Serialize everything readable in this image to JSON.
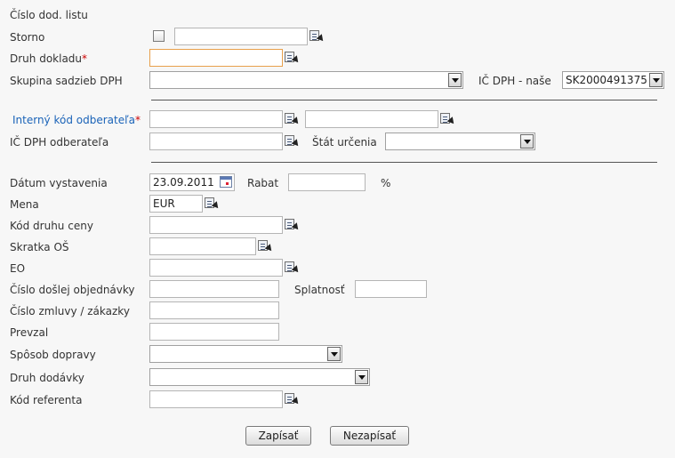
{
  "labels": {
    "cislo_dod_listu": "Číslo dod. listu",
    "storno": "Storno",
    "druh_dokladu": "Druh dokladu",
    "skupina_sadzieb": "Skupina sadzieb DPH",
    "ic_dph_nase": "IČ DPH - naše",
    "interny_kod": "Interný kód odberateľa",
    "ic_dph_odberatela": "IČ DPH odberateľa",
    "stat_urcenia": "Štát určenia",
    "datum_vystavenia": "Dátum vystavenia",
    "rabat": "Rabat",
    "percent": "%",
    "mena": "Mena",
    "kod_druhu_ceny": "Kód druhu ceny",
    "skratka_os": "Skratka OŠ",
    "eo": "EO",
    "cislo_objednavky": "Číslo došlej objednávky",
    "splatnost": "Splatnosť",
    "cislo_zmluvy": "Číslo zmluvy / zákazky",
    "prevzal": "Prevzal",
    "sposob_dopravy": "Spôsob dopravy",
    "druh_dodavky": "Druh dodávky",
    "kod_referenta": "Kód referenta",
    "required_mark": "*"
  },
  "values": {
    "storno_text": "",
    "druh_dokladu": "",
    "skupina_sadzieb": "",
    "ic_dph_nase": "SK2000491375",
    "interny_kod": "",
    "interny_kod_name": "",
    "ic_dph_odberatela": "",
    "stat_urcenia": "",
    "datum_vystavenia": "23.09.2011",
    "rabat": "",
    "mena": "EUR",
    "kod_druhu_ceny": "",
    "skratka_os": "",
    "eo": "",
    "cislo_objednavky": "",
    "splatnost": "",
    "cislo_zmluvy": "",
    "prevzal": "",
    "sposob_dopravy": "",
    "druh_dodavky": "",
    "kod_referenta": ""
  },
  "buttons": {
    "save": "Zapísať",
    "cancel": "Nezapísať"
  },
  "icons": {
    "picker": "lookup-picker-icon",
    "calendar": "calendar-icon",
    "dropdown": "dropdown-arrow-icon"
  },
  "colors": {
    "label_blue": "#1a63b8",
    "required_red": "#cc0000",
    "focus_border": "#e8a04c"
  }
}
